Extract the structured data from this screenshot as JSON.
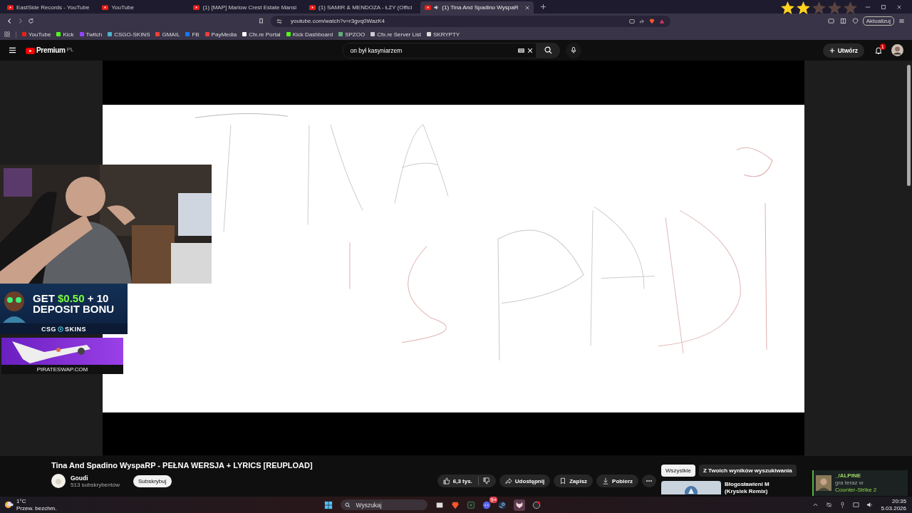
{
  "tabs": [
    {
      "title": "EastSide Records - YouTube",
      "selected": false,
      "audio": false
    },
    {
      "title": "YouTube",
      "selected": false,
      "audio": false
    },
    {
      "title": "(1) [MAP] Marlow Crest Estate Mansi",
      "selected": false,
      "audio": false
    },
    {
      "title": "(1) SAMIR & MENDOZA - ŁZY (Offici",
      "selected": false,
      "audio": false
    },
    {
      "title": "(1) Tina And Spadino WyspaR",
      "selected": true,
      "audio": true
    }
  ],
  "address_bar": {
    "url": "youtube.com/watch?v=r3gvq0WazK4",
    "update_button": "Aktualizuj"
  },
  "bookmarks": [
    {
      "label": "YouTube",
      "color": "#e62117"
    },
    {
      "label": "Kick",
      "color": "#53fc18"
    },
    {
      "label": "Twitch",
      "color": "#9146ff"
    },
    {
      "label": "CSGO-SKINS",
      "color": "#4fb3c8"
    },
    {
      "label": "GMAIL",
      "color": "#ea4335"
    },
    {
      "label": "FB",
      "color": "#1877f2"
    },
    {
      "label": "PayMedia",
      "color": "#e8403a"
    },
    {
      "label": "Cfx.re Portal",
      "color": "#ffffff"
    },
    {
      "label": "Kick Dashboard",
      "color": "#53fc18"
    },
    {
      "label": "SPZOO",
      "color": "#5fb07a"
    },
    {
      "label": "Cfx.re Server List",
      "color": "#cccccc"
    },
    {
      "label": "SKRYPTY",
      "color": "#dddddd"
    }
  ],
  "youtube_header": {
    "logo": "Premium",
    "region": "PL",
    "search": {
      "value": "on był kasyniarzem"
    },
    "create_button": "Utwórz",
    "notification_count": "1"
  },
  "video": {
    "title": "Tina And Spadino WyspaRP - PEŁNA WERSJA + LYRICS [REUPLOAD]",
    "channel": "Goudi",
    "subscribers": "513 subskrybentów",
    "subscribe_button": "Subskrybuj",
    "likes": "6,3 tys.",
    "actions": [
      "Udostępnij",
      "Zapisz",
      "Pobierz"
    ]
  },
  "chips": [
    {
      "label": "Wszystkie",
      "selected": true
    },
    {
      "label": "Z Twoich wyników wyszukiwania",
      "selected": false
    }
  ],
  "recommendations": [
    {
      "title": "Błogosławieni M",
      "subtitle": "(Krysiek Remix)"
    }
  ],
  "stream_overlay": {
    "rating": {
      "stars": 2
    },
    "ad_banner": {
      "prefix": "GET",
      "amount": "$0.50",
      "suffix": "+ 10",
      "line_2": "DEPOSIT BONU",
      "brand_left": "CSG",
      "brand_right": "SKINS"
    },
    "pirate_banner": {
      "site": "PIRATESWAP.COM"
    },
    "toast": {
      "name": "_/ALPINE",
      "status": "gra teraz w",
      "game": "Counter-Strike 2"
    }
  },
  "taskbar": {
    "weather": {
      "temperature": "1°C",
      "condition": "Przew. bezchm."
    },
    "search_placeholder": "Wyszukaj",
    "chat_badge": "9+",
    "time": "20:35",
    "date": "5.03.2026"
  }
}
